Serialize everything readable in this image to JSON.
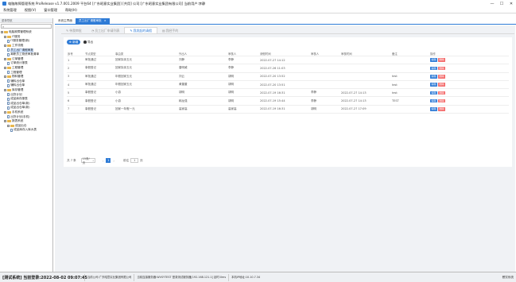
{
  "window": {
    "title": "电脑故障管理系统 ProRelease v1.7.001.2009 平台64 [广东昭意实业集团] [共用] 公司:[广东昭意实业集团有限公司] 当前用户:李静",
    "controls": [
      "—",
      "☐",
      "✕"
    ]
  },
  "menu": [
    "系统管理",
    "视图(V)",
    "窗口管理",
    "帮助(H)"
  ],
  "sidebar": {
    "header": "菜单导航",
    "search_icon": "search-icon",
    "items": [
      {
        "label": "电脑故障管理系统",
        "level": 0,
        "icon": "folder"
      },
      {
        "label": "IT服务",
        "level": 1,
        "icon": "folder"
      },
      {
        "label": "IT服务管理(新)",
        "level": 2,
        "icon": "doc"
      },
      {
        "label": "工作流程",
        "level": 1,
        "icon": "folder"
      },
      {
        "label": "员工出厂请假审批",
        "level": 2,
        "icon": "doc",
        "selected": true
      },
      {
        "label": "离职员工物资审批清单",
        "level": 2,
        "icon": "doc"
      },
      {
        "label": "订单管理",
        "level": 1,
        "icon": "folder"
      },
      {
        "label": "订单统计报表",
        "level": 2,
        "icon": "doc"
      },
      {
        "label": "工程管理",
        "level": 1,
        "icon": "folder"
      },
      {
        "label": "工程管理",
        "level": 2,
        "icon": "doc"
      },
      {
        "label": "物料管理",
        "level": 1,
        "icon": "folder"
      },
      {
        "label": "辅料出仓单",
        "level": 2,
        "icon": "doc"
      },
      {
        "label": "辅料出仓单",
        "level": 2,
        "icon": "doc"
      },
      {
        "label": "库存管理",
        "level": 1,
        "icon": "folder"
      },
      {
        "label": "出货计划",
        "level": 2,
        "icon": "doc"
      },
      {
        "label": "成品库存报表",
        "level": 2,
        "icon": "doc"
      },
      {
        "label": "成品出仓单(新)",
        "level": 2,
        "icon": "doc"
      },
      {
        "label": "成品出仓单(新)",
        "level": 2,
        "icon": "doc"
      },
      {
        "label": "手机系统",
        "level": 1,
        "icon": "folder"
      },
      {
        "label": "出货计划(手机)",
        "level": 2,
        "icon": "doc"
      },
      {
        "label": "报表系统",
        "level": 1,
        "icon": "folder"
      },
      {
        "label": "成品出仓",
        "level": 2,
        "icon": "folder"
      },
      {
        "label": "成品库存入库大表",
        "level": 3,
        "icon": "doc"
      }
    ]
  },
  "doc_tabs": [
    {
      "label": "系统主界面",
      "active": false
    },
    {
      "label": "员工出厂请假审批",
      "active": true,
      "close": "×"
    }
  ],
  "sub_tabs": [
    {
      "label": "待我审批",
      "active": false
    },
    {
      "label": "员工出厂申请列表",
      "active": false
    },
    {
      "label": "我发起的请假",
      "active": true
    },
    {
      "label": "我经手的",
      "active": false
    }
  ],
  "toolbar": {
    "add_label": "新增",
    "export_label": "导出"
  },
  "table": {
    "columns": [
      "序号",
      "节点类型",
      "事由类",
      "外出人",
      "审核人",
      "请假时间",
      "审核人",
      "审核时间",
      "备注",
      "操作"
    ],
    "rows": [
      {
        "no": "1",
        "node": "审批通过",
        "reason": "回家探亲五元",
        "person": "刘静",
        "auditor": "李静",
        "time": "2022-07-27 14:12",
        "auditor2": "",
        "audit_time": "",
        "remark": ""
      },
      {
        "no": "2",
        "node": "事假登记",
        "reason": "回家探亲五元",
        "person": "唐明威",
        "auditor": "李静",
        "time": "2022-07-26 11:03",
        "auditor2": "",
        "audit_time": "",
        "remark": ""
      },
      {
        "no": "3",
        "node": "审批通过",
        "reason": "年假回家五元",
        "person": "刘云",
        "auditor": "胡明",
        "time": "2022-07-20 13:52",
        "auditor2": "",
        "audit_time": "",
        "remark": "test"
      },
      {
        "no": "4",
        "node": "审批通过",
        "reason": "年假回家五元",
        "person": "黄董董",
        "auditor": "胡明",
        "time": "2022-07-20 13:51",
        "auditor2": "",
        "audit_time": "",
        "remark": "test"
      },
      {
        "no": "5",
        "node": "事假登记",
        "reason": "小游",
        "person": "胡明",
        "auditor": "胡明",
        "time": "2022-07-19 16:31",
        "auditor2": "李静",
        "audit_time": "2022-07-27 14:13",
        "remark": "test"
      },
      {
        "no": "6",
        "node": "事假登记",
        "reason": "小游",
        "person": "韩龙强",
        "auditor": "胡明",
        "time": "2022-07-19 15:44",
        "auditor2": "李静",
        "audit_time": "2022-07-27 14:13",
        "remark": "TEST"
      },
      {
        "no": "7",
        "node": "事假登记",
        "reason": "回家一年假一元",
        "person": "高家高",
        "auditor": "高家高",
        "time": "2022-07-19 16:31",
        "auditor2": "胡明",
        "audit_time": "2022-07-27 17:09",
        "remark": ""
      }
    ],
    "edit_label": "编辑",
    "delete_label": "删除"
  },
  "pager": {
    "total": "共 7 条",
    "page_size": "15条/页",
    "current": "1",
    "goto_label": "前往",
    "goto_value": "1",
    "page_suffix": "页"
  },
  "status": {
    "login": "[测试系统] 当前登录:2022-08-02 09:07:45",
    "company": "当前公司:广东昭意实业集团有限公司",
    "server": "当前连接服务器:WVSYTEST 登录测试服务器[192.168.121.1] 延时:0ms",
    "ip": "本机IP地址:10.10.7.34",
    "right": "餐饮系统"
  },
  "colors": {
    "accent": "#2e7bd6",
    "danger": "#f46b6b"
  }
}
